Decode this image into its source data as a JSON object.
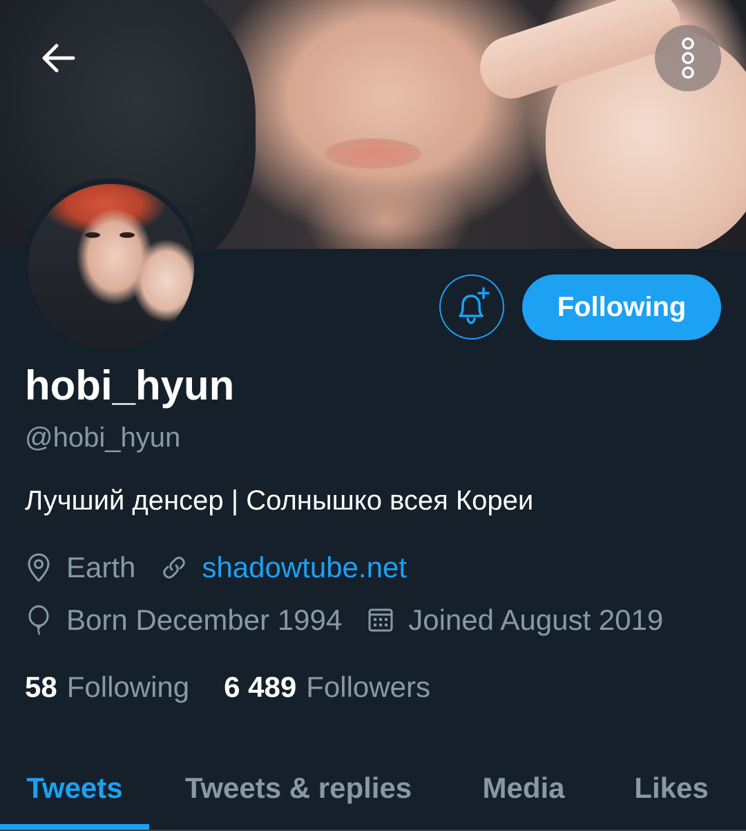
{
  "header": {
    "back_icon": "arrow-left-icon",
    "more_icon": "more-vertical-icon"
  },
  "profile": {
    "display_name": "hobi_hyun",
    "handle": "@hobi_hyun",
    "bio": "Лучший денсер | Солнышко всея Кореи",
    "location": "Earth",
    "website": "shadowtube.net",
    "birth": "Born December 1994",
    "joined": "Joined August 2019"
  },
  "actions": {
    "notify_icon": "bell-plus-icon",
    "following_label": "Following"
  },
  "stats": {
    "following_count": "58",
    "following_label": "Following",
    "followers_count": "6 489",
    "followers_label": "Followers"
  },
  "tabs": [
    {
      "label": "Tweets",
      "active": true
    },
    {
      "label": "Tweets & replies",
      "active": false
    },
    {
      "label": "Media",
      "active": false
    },
    {
      "label": "Likes",
      "active": false
    }
  ],
  "colors": {
    "background": "#15202b",
    "accent": "#1da1f2",
    "secondary_text": "#8899a6",
    "primary_text": "#ffffff"
  }
}
